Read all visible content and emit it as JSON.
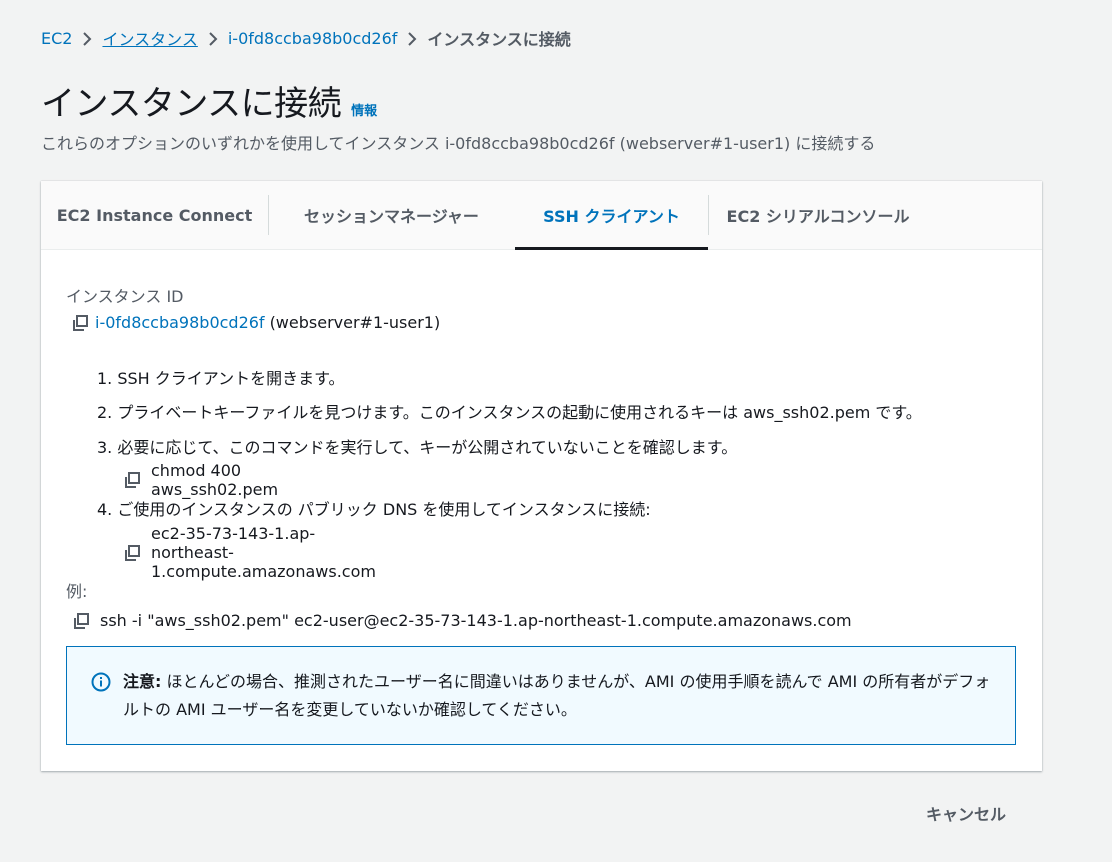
{
  "breadcrumb": {
    "items": [
      "EC2",
      "インスタンス",
      "i-0fd8ccba98b0cd26f",
      "インスタンスに接続"
    ]
  },
  "header": {
    "title": "インスタンスに接続",
    "info_link": "情報",
    "subtitle": "これらのオプションのいずれかを使用してインスタンス i-0fd8ccba98b0cd26f (webserver#1-user1) に接続する"
  },
  "tabs": [
    {
      "label": "EC2 Instance Connect"
    },
    {
      "label": "セッションマネージャー"
    },
    {
      "label": "SSH クライアント",
      "active": true
    },
    {
      "label": "EC2 シリアルコンソール"
    }
  ],
  "ssh_client": {
    "instance_id_label": "インスタンス ID",
    "instance_id": "i-0fd8ccba98b0cd26f",
    "instance_name": "(webserver#1-user1)",
    "steps": [
      "1. SSH クライアントを開きます。",
      "2. プライベートキーファイルを見つけます。このインスタンスの起動に使用されるキーは aws_ssh02.pem です。",
      "3. 必要に応じて、このコマンドを実行して、キーが公開されていないことを確認します。",
      "4. ご使用のインスタンスの パブリック DNS を使用してインスタンスに接続:"
    ],
    "chmod_command": "chmod 400 aws_ssh02.pem",
    "public_dns": "ec2-35-73-143-1.ap-northeast-1.compute.amazonaws.com",
    "example_label": "例:",
    "example_command": "ssh -i \"aws_ssh02.pem\" ec2-user@ec2-35-73-143-1.ap-northeast-1.compute.amazonaws.com",
    "note_strong": "注意:",
    "note_text": " ほとんどの場合、推測されたユーザー名に間違いはありませんが、AMI の使用手順を読んで AMI の所有者がデフォルトの AMI ユーザー名を変更していないか確認してください。"
  },
  "footer": {
    "cancel_label": "キャンセル"
  },
  "colors": {
    "link": "#0073bb",
    "active_tab_underline": "#16191f",
    "note_border": "#0073bb",
    "note_bg": "#f1faff"
  }
}
